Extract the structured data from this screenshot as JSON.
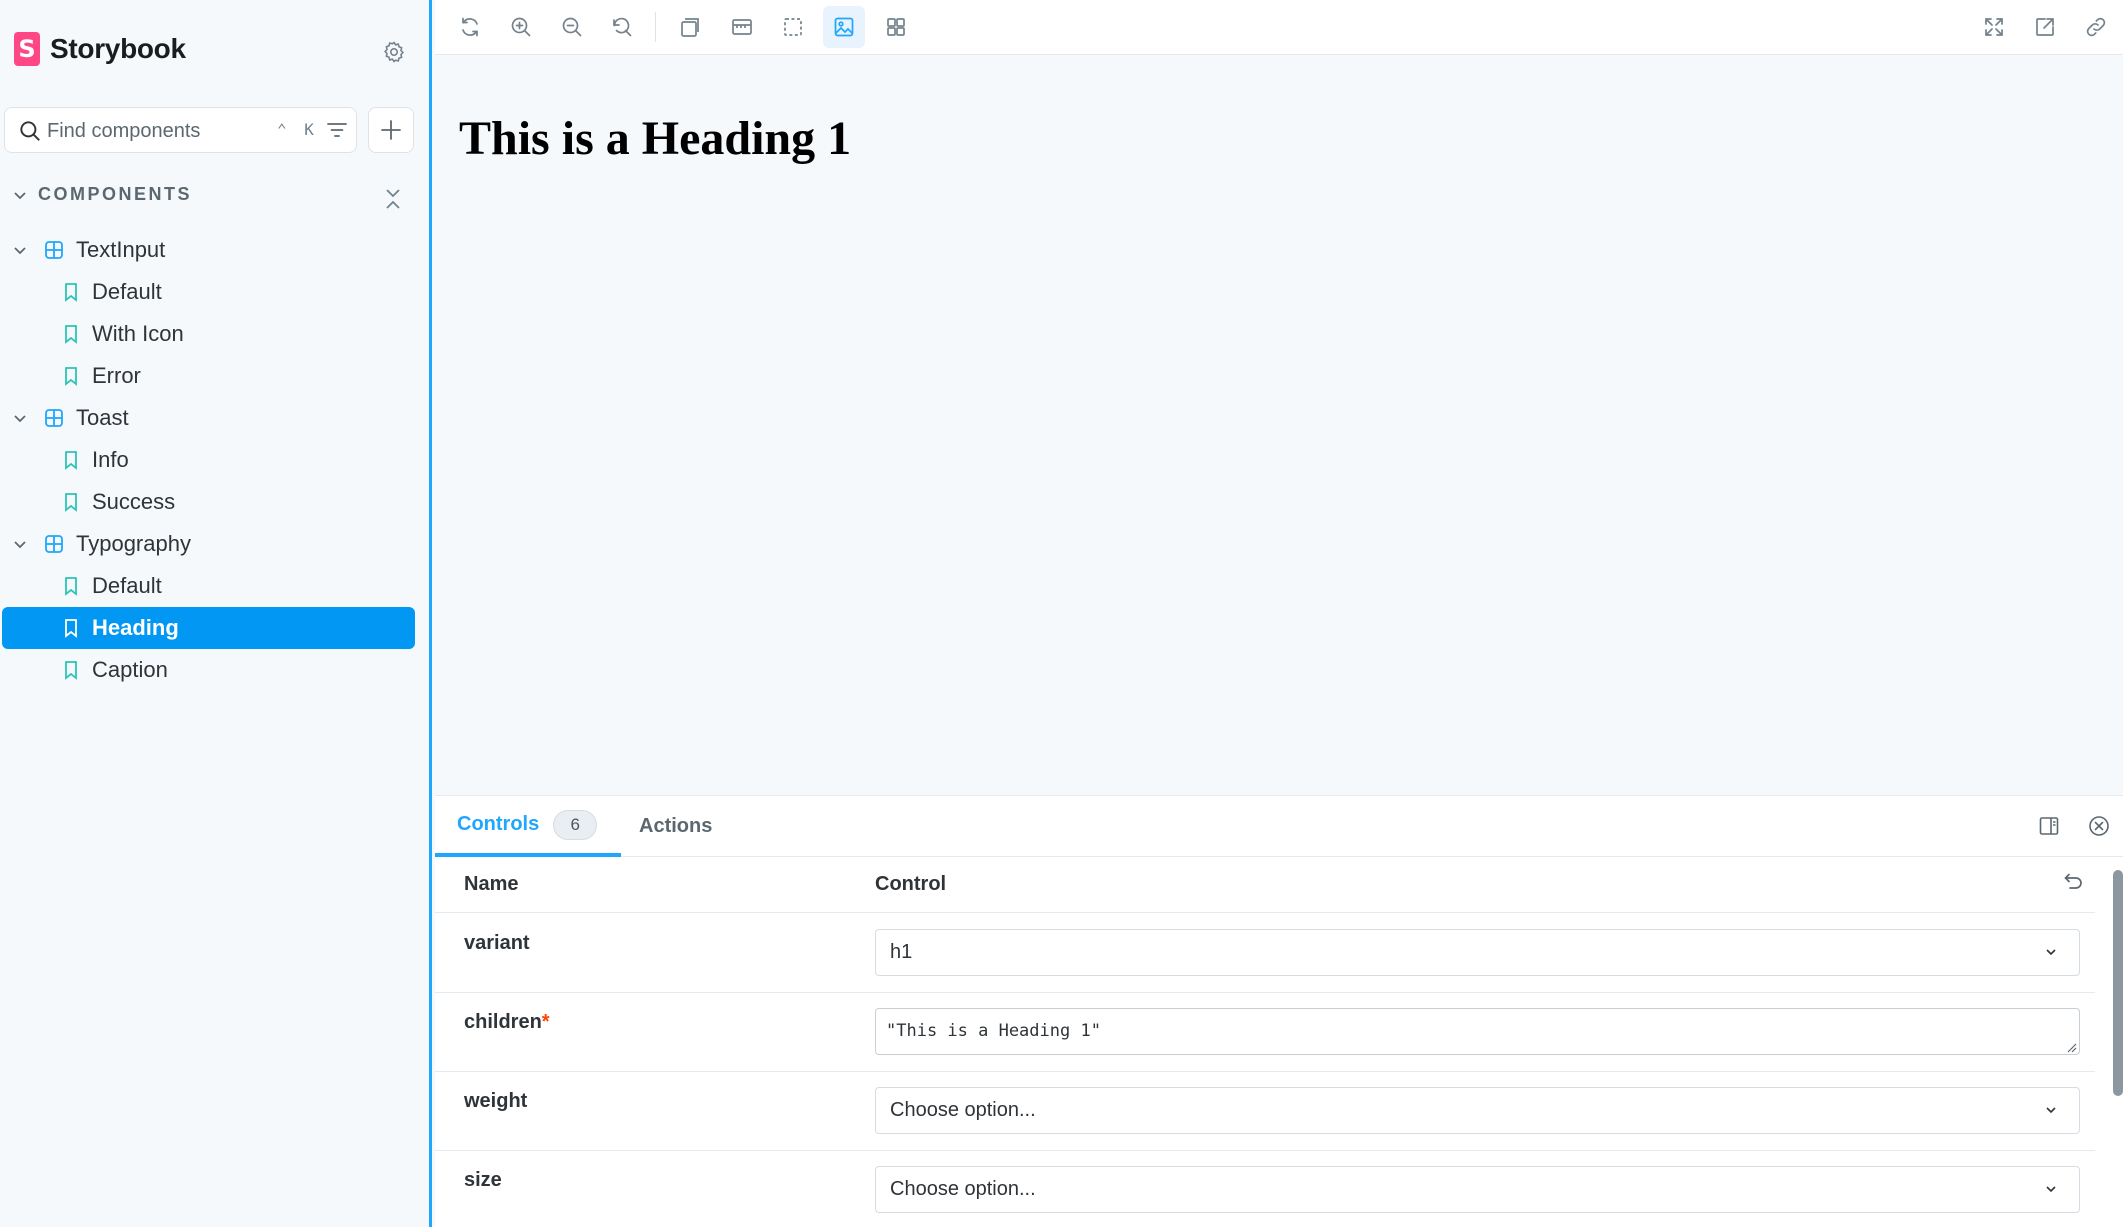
{
  "brand": {
    "name": "Storybook",
    "logo_letter": "S",
    "logo_color": "#ff4785"
  },
  "search": {
    "placeholder": "Find components",
    "shortcut": "⌃ K"
  },
  "sidebar": {
    "section_title": "COMPONENTS",
    "groups": [
      {
        "label": "TextInput",
        "stories": [
          "Default",
          "With Icon",
          "Error"
        ]
      },
      {
        "label": "Toast",
        "stories": [
          "Info",
          "Success"
        ]
      },
      {
        "label": "Typography",
        "stories": [
          "Default",
          "Heading",
          "Caption"
        ]
      }
    ],
    "selected_story": "Heading",
    "accent_color": "#1ea7fd",
    "selected_color": "#0297f3"
  },
  "toolbar": {
    "left_icons": [
      "reload-icon",
      "zoom-in-icon",
      "zoom-out-icon",
      "reset-zoom-icon",
      "background-icon",
      "viewport-icon",
      "outline-icon",
      "measure-icon",
      "grid-icon"
    ],
    "right_icons": [
      "fullscreen-icon",
      "open-new-tab-icon",
      "copy-link-icon"
    ]
  },
  "canvas": {
    "heading_text": "This is a Heading 1"
  },
  "panel": {
    "tabs": [
      {
        "label": "Controls",
        "count": "6"
      },
      {
        "label": "Actions"
      }
    ],
    "columns": {
      "name": "Name",
      "control": "Control"
    },
    "rows": [
      {
        "name": "variant",
        "required": false,
        "type": "select",
        "value": "h1"
      },
      {
        "name": "children",
        "required": true,
        "required_mark": "*",
        "type": "text",
        "value": "\"This is a Heading 1\""
      },
      {
        "name": "weight",
        "required": false,
        "type": "select",
        "value": "Choose option..."
      },
      {
        "name": "size",
        "required": false,
        "type": "select",
        "value": "Choose option..."
      }
    ]
  }
}
